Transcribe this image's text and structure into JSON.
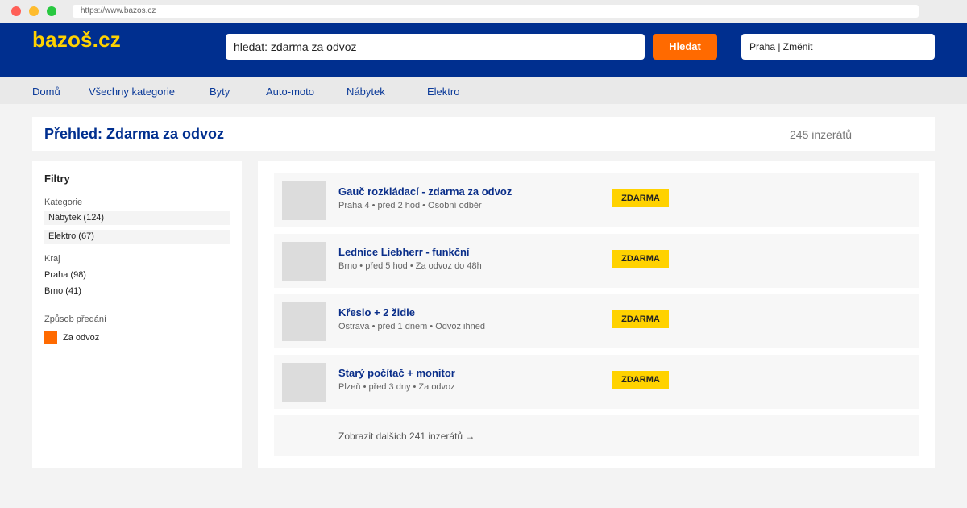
{
  "browser": {
    "url": "https://www.bazos.cz"
  },
  "header": {
    "logo": "bazoš.cz",
    "search_value": "hledat: zdarma za odvoz",
    "search_button": "Hledat",
    "location": "Praha | Změnit"
  },
  "nav": {
    "items": [
      {
        "label": "Domů"
      },
      {
        "label": "Všechny kategorie"
      },
      {
        "label": "Byty"
      },
      {
        "label": "Auto-moto"
      },
      {
        "label": "Nábytek"
      },
      {
        "label": "Elektro"
      }
    ]
  },
  "page": {
    "title": "Přehled: Zdarma za odvoz",
    "count": "245 inzerátů"
  },
  "filters": {
    "title": "Filtry",
    "category_label": "Kategorie",
    "categories": [
      {
        "label": "Nábytek (124)"
      },
      {
        "label": "Elektro (67)"
      }
    ],
    "region_label": "Kraj",
    "regions": [
      {
        "label": "Praha (98)"
      },
      {
        "label": "Brno (41)"
      }
    ],
    "handover_label": "Způsob předání",
    "handover_option": "Za odvoz",
    "handover_color": "#ff6a00"
  },
  "listings": [
    {
      "title": "Gauč rozkládací - zdarma za odvoz",
      "meta": "Praha 4 • před 2 hod • Osobní odběr",
      "badge": "ZDARMA"
    },
    {
      "title": "Lednice Liebherr - funkční",
      "meta": "Brno • před 5 hod • Za odvoz do 48h",
      "badge": "ZDARMA"
    },
    {
      "title": "Křeslo + 2 židle",
      "meta": "Ostrava • před 1 dnem • Odvoz ihned",
      "badge": "ZDARMA"
    },
    {
      "title": "Starý počítač + monitor",
      "meta": "Plzeň • před 3 dny • Za odvoz",
      "badge": "ZDARMA"
    }
  ],
  "more_link": "Zobrazit dalších 241 inzerátů →",
  "colors": {
    "header_bg": "#002f8f",
    "logo": "#ffd200",
    "accent": "#ff6a00",
    "badge": "#ffd200"
  }
}
